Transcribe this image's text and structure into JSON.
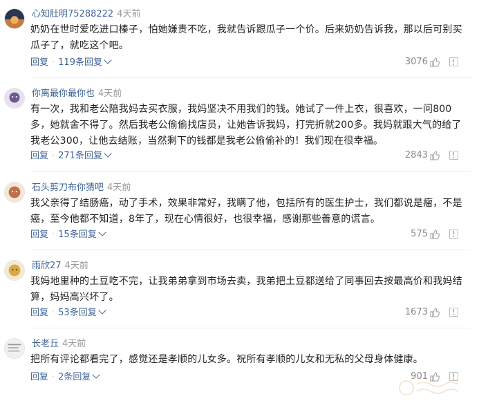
{
  "comments": [
    {
      "user": "心知肚明75288222",
      "time": "4天前",
      "text": "奶奶在世时爱吃进口榛子，怕她嫌贵不吃，我就告诉跟瓜子一个价。后来奶奶告诉我，那以后可别买瓜子了，就吃这个吧。",
      "reply_label": "回复",
      "replies": "119条回复",
      "likes": "3076"
    },
    {
      "user": "你离最你最你也",
      "time": "4天前",
      "text": "有一次，我和老公陪我妈去买衣服，我妈坚决不用我们的钱。她试了一件上衣，很喜欢，一问800多，她就舍不得了。然后我老公偷偷找店员，让她告诉我妈，打完折就200多。我妈就跟大气的给了我老公300，让他去结账，当然剩下的钱都是我老公偷偷补的！我们现在很幸福。",
      "reply_label": "回复",
      "replies": "271条回复",
      "likes": "2843"
    },
    {
      "user": "石头剪刀布你猜吧",
      "time": "4天前",
      "text": "我父亲得了结肠癌，动了手术，效果非常好，我瞒了他，包括所有的医生护士，我们都说是瘤，不是癌，至今他都不知道，8年了，现在心情很好，也很幸福，感谢那些善意的谎言。",
      "reply_label": "回复",
      "replies": "15条回复",
      "likes": "575"
    },
    {
      "user": "雨欣27",
      "time": "4天前",
      "text": "我妈地里种的土豆吃不完，让我弟弟拿到市场去卖，我弟把土豆都送给了同事回去按最高价和我妈结算，妈妈高兴坏了。",
      "reply_label": "回复",
      "replies": "53条回复",
      "likes": "1673"
    },
    {
      "user": "长老丘",
      "time": "4天前",
      "text": "把所有评论都看完了，感觉还是孝顺的儿女多。祝所有孝顺的儿女和无私的父母身体健康。",
      "reply_label": "回复",
      "replies": "2条回复",
      "likes": "901"
    }
  ],
  "icons": {
    "like": "thumbs-up-icon",
    "report": "report-icon",
    "expand": "chevron-down-icon"
  },
  "colors": {
    "username": "#406599",
    "link": "#406599",
    "muted": "#999999"
  }
}
